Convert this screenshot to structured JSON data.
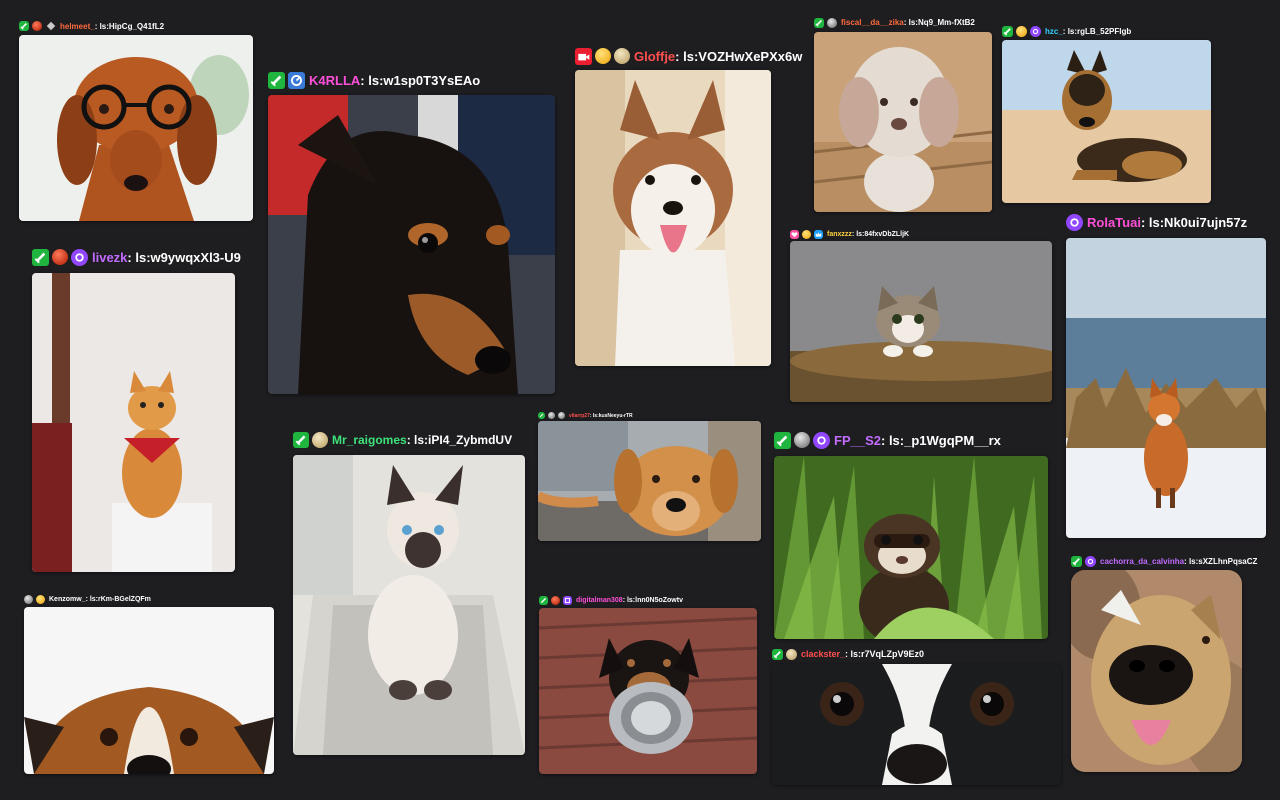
{
  "posts": [
    {
      "username": "helmeet_",
      "message": "ls:HipCg_Q41fL2",
      "user_color": "#ff6a3d",
      "photo": "dachshund wearing glasses"
    },
    {
      "username": "K4RLLA",
      "message": "ls:w1sp0T3YsEAo",
      "user_color": "#ff4fd8",
      "photo": "black and tan dog"
    },
    {
      "username": "Gloffje",
      "message": "ls:VOZHwXePXx6w",
      "user_color": "#ff4f4f",
      "photo": "husky sitting indoors"
    },
    {
      "username": "fiscal__da__zika",
      "message": "ls:Nq9_Mm-fXtB2",
      "user_color": "#ff6a3d",
      "photo": "fluffy poodle on bench"
    },
    {
      "username": "hzc_",
      "message": "ls:rgLB_52PFlgb",
      "user_color": "#33d0ff",
      "photo": "german shepherd on beach"
    },
    {
      "username": "livezk",
      "message": "ls:w9ywqxXl3-U9",
      "user_color": "#c26bff",
      "photo": "orange cat with red bandana"
    },
    {
      "username": "fanxzzz",
      "message": "ls:84fxvDbZLljK",
      "user_color": "#ffd23f",
      "photo": "kitten peeking over couch"
    },
    {
      "username": "RolaTuai",
      "message": "ls:Nk0ui7ujn57z",
      "user_color": "#ff4fd8",
      "photo": "fox in snow"
    },
    {
      "username": "Mr_raigomes",
      "message": "ls:iPI4_ZybmdUV",
      "user_color": "#3ee27a",
      "photo": "siamese cat on stool"
    },
    {
      "username": "vilarrp27",
      "message": "ls:kusNeeyu-rTR",
      "user_color": "#ff4f4f",
      "photo": "dog in street"
    },
    {
      "username": "FP__S2",
      "message": "ls:_p1WgqPM__rx",
      "user_color": "#c26bff",
      "photo": "ferret in grass"
    },
    {
      "username": "Kenzomw_",
      "message": "ls:rKm-BGelZQFm",
      "user_color": "#ffffff",
      "photo": "dog peeking from bottom"
    },
    {
      "username": "digitalman308",
      "message": "ls:lnn0N5oZowtv",
      "user_color": "#ff4fd8",
      "photo": "puppy holding bowl"
    },
    {
      "username": "clackster_",
      "message": "ls:r7VqLZpV9Ez0",
      "user_color": "#ff4f4f",
      "photo": "boston terrier close-up"
    },
    {
      "username": "cachorra_da_calvinha",
      "message": "ls:sXZLhnPqsaCZ",
      "user_color": "#c26bff",
      "photo": "dog fisheye nose"
    }
  ]
}
